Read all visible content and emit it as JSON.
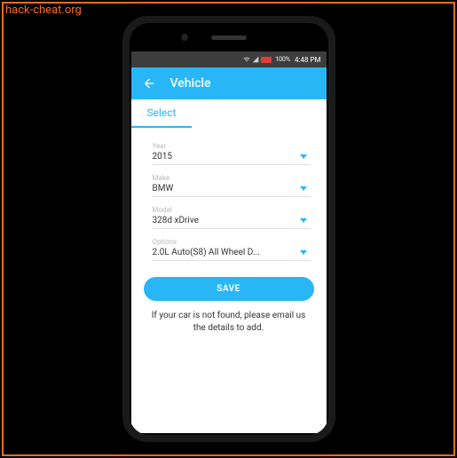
{
  "watermark": "hack-cheat.org",
  "status": {
    "battery_text": "100%",
    "time": "4:48 PM"
  },
  "appbar": {
    "title": "Vehicle"
  },
  "tab": {
    "select": "Select"
  },
  "form": {
    "year": {
      "label": "Year",
      "value": "2015"
    },
    "make": {
      "label": "Make",
      "value": "BMW"
    },
    "model": {
      "label": "Model",
      "value": "328d xDrive"
    },
    "options": {
      "label": "Options",
      "value": "2.0L Auto(S8) All Wheel D..."
    }
  },
  "buttons": {
    "save": "SAVE"
  },
  "footer": {
    "text": "If your car is not found, please email us the details to add."
  }
}
